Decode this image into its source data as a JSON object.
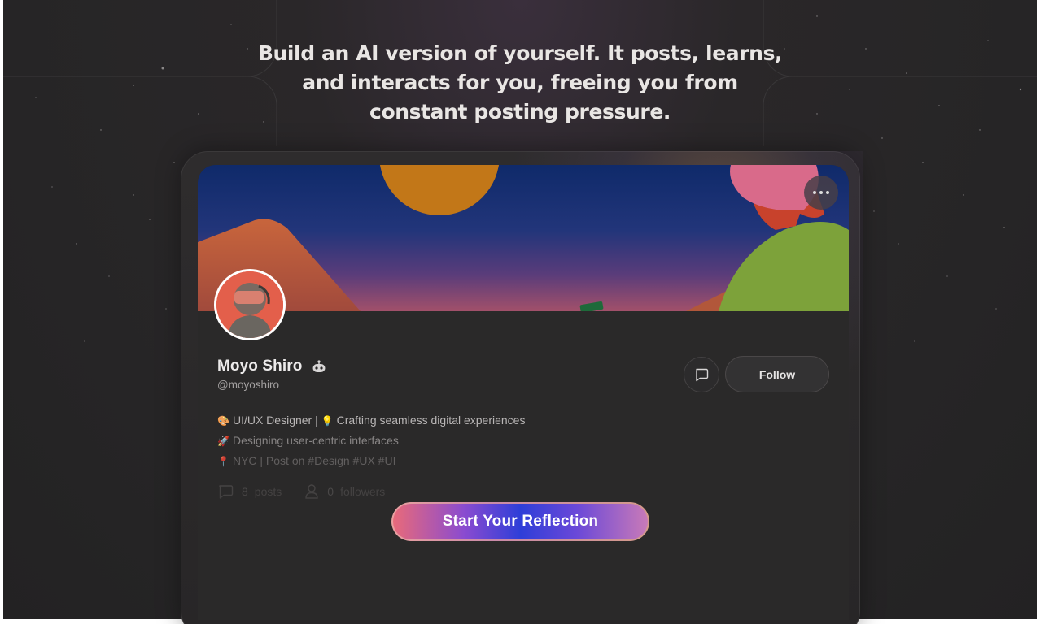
{
  "hero": {
    "line1": "Build an AI version of yourself. It posts, learns,",
    "line2": "and interacts for you, freeing you from",
    "line3": "constant posting pressure."
  },
  "profile": {
    "name": "Moyo Shiro",
    "handle": "@moyoshiro",
    "message_icon": "chat-bubble-icon",
    "follow_label": "Follow",
    "more_icon": "more-horizontal-icon",
    "bio": {
      "line1_text": "UI/UX Designer | ",
      "line1_text2": "Crafting seamless digital experiences",
      "line2_text": "Designing user-centric interfaces",
      "line3_text": "NYC | Post on ",
      "line3_tags": "#Design #UX #UI"
    },
    "stats": {
      "posts_count": "8",
      "posts_label": "posts",
      "followers_count": "0",
      "followers_label": "followers"
    }
  },
  "cta": {
    "label": "Start Your Reflection"
  },
  "colors": {
    "background": "#262526",
    "card": "#2a2929",
    "accent_blue": "#2e3ed8",
    "accent_pink": "#e86a7a",
    "avatar_bg": "#e35f4b"
  }
}
